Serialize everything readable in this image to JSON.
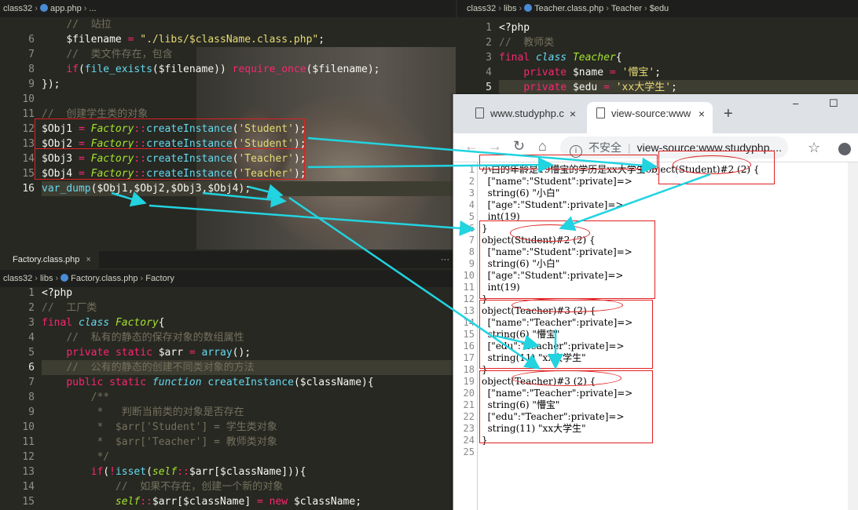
{
  "colors": {
    "editor_bg": "#272822",
    "keyword": "#f92672",
    "type": "#66d9ef",
    "string": "#e6db74",
    "comment": "#75715e",
    "func": "#a6e22e",
    "arrow": "#22d3e0",
    "annotation": "#e02020"
  },
  "app_pane": {
    "breadcrumb": [
      "class32",
      "app.php",
      "..."
    ],
    "lines": [
      {
        "n": "",
        "t": "    //  站拉"
      },
      {
        "n": "6",
        "t": "    $filename = \"./libs/$className.class.php\";"
      },
      {
        "n": "7",
        "t": "    //  类文件存在，包含"
      },
      {
        "n": "8",
        "t": "    if(file_exists($filename)) require_once($filename);"
      },
      {
        "n": "9",
        "t": "});"
      },
      {
        "n": "10",
        "t": ""
      },
      {
        "n": "11",
        "t": "//  创建学生类的对象"
      },
      {
        "n": "12",
        "t": "$Obj1 = Factory::createInstance('Student');"
      },
      {
        "n": "13",
        "t": "$Obj2 = Factory::createInstance('Student');"
      },
      {
        "n": "14",
        "t": "$Obj3 = Factory::createInstance('Teacher');"
      },
      {
        "n": "15",
        "t": "$Obj4 = Factory::createInstance('Teacher');"
      },
      {
        "n": "16",
        "t": "var_dump($Obj1,$Obj2,$Obj3,$Obj4);"
      }
    ]
  },
  "factory_pane": {
    "tab": "Factory.class.php",
    "tab_close": "×",
    "more": "···",
    "breadcrumb": [
      "class32",
      "libs",
      "Factory.class.php",
      "Factory"
    ],
    "lines": [
      {
        "n": "1",
        "t": "<?php"
      },
      {
        "n": "2",
        "t": "//  工厂类"
      },
      {
        "n": "3",
        "t": "final class Factory{"
      },
      {
        "n": "4",
        "t": "    //  私有的静态的保存对象的数组属性"
      },
      {
        "n": "5",
        "t": "    private static $arr = array();"
      },
      {
        "n": "6",
        "t": "    //  公有的静态的创建不同类对象的方法"
      },
      {
        "n": "7",
        "t": "    public static function createInstance($className){"
      },
      {
        "n": "8",
        "t": "        /**"
      },
      {
        "n": "9",
        "t": "         *   判断当前类的对象是否存在"
      },
      {
        "n": "10",
        "t": "         *  $arr['Student'] = 学生类对象"
      },
      {
        "n": "11",
        "t": "         *  $arr['Teacher'] = 教师类对象"
      },
      {
        "n": "12",
        "t": "         */"
      },
      {
        "n": "13",
        "t": "        if(!isset(self::$arr[$className])){"
      },
      {
        "n": "14",
        "t": "            //  如果不存在，创建一个新的对象"
      },
      {
        "n": "15",
        "t": "            self::$arr[$className] = new $className;"
      }
    ]
  },
  "teacher_pane": {
    "breadcrumb": [
      "class32",
      "libs",
      "Teacher.class.php",
      "Teacher",
      "$edu"
    ],
    "lines": [
      {
        "n": "1",
        "t": "<?php"
      },
      {
        "n": "2",
        "t": "//  教师类"
      },
      {
        "n": "3",
        "t": "final class Teacher{"
      },
      {
        "n": "4",
        "t": "    private $name = '懵宝';"
      },
      {
        "n": "5",
        "t": "    private $edu = 'xx大学生';"
      }
    ]
  },
  "browser": {
    "tab1": "www.studyphp.c",
    "tab2": "view-source:www",
    "tab_close": "×",
    "new_tab": "+",
    "win_min": "–",
    "win_max": "☐",
    "win_close": "✕",
    "back": "←",
    "forward": "→",
    "reload": "↻",
    "home": "⌂",
    "info": "i",
    "insecure": "不安全",
    "divider": "|",
    "url": "view-source:www.studyphp....",
    "star": "☆",
    "source_lines": [
      {
        "n": "1",
        "t": "小白的年龄是19懵宝的学历是xx大学生object(Student)#2 (2) {"
      },
      {
        "n": "2",
        "t": "  [\"name\":\"Student\":private]=>"
      },
      {
        "n": "3",
        "t": "  string(6) \"小白\""
      },
      {
        "n": "4",
        "t": "  [\"age\":\"Student\":private]=>"
      },
      {
        "n": "5",
        "t": "  int(19)"
      },
      {
        "n": "6",
        "t": "}"
      },
      {
        "n": "7",
        "t": "object(Student)#2 (2) {"
      },
      {
        "n": "8",
        "t": "  [\"name\":\"Student\":private]=>"
      },
      {
        "n": "9",
        "t": "  string(6) \"小白\""
      },
      {
        "n": "10",
        "t": "  [\"age\":\"Student\":private]=>"
      },
      {
        "n": "11",
        "t": "  int(19)"
      },
      {
        "n": "12",
        "t": "}"
      },
      {
        "n": "13",
        "t": "object(Teacher)#3 (2) {"
      },
      {
        "n": "14",
        "t": "  [\"name\":\"Teacher\":private]=>"
      },
      {
        "n": "15",
        "t": "  string(6) \"懵宝\""
      },
      {
        "n": "16",
        "t": "  [\"edu\":\"Teacher\":private]=>"
      },
      {
        "n": "17",
        "t": "  string(11) \"xx大学生\""
      },
      {
        "n": "18",
        "t": "}"
      },
      {
        "n": "19",
        "t": "object(Teacher)#3 (2) {"
      },
      {
        "n": "20",
        "t": "  [\"name\":\"Teacher\":private]=>"
      },
      {
        "n": "21",
        "t": "  string(6) \"懵宝\""
      },
      {
        "n": "22",
        "t": "  [\"edu\":\"Teacher\":private]=>"
      },
      {
        "n": "23",
        "t": "  string(11) \"xx大学生\""
      },
      {
        "n": "24",
        "t": "}"
      },
      {
        "n": "25",
        "t": ""
      }
    ]
  }
}
